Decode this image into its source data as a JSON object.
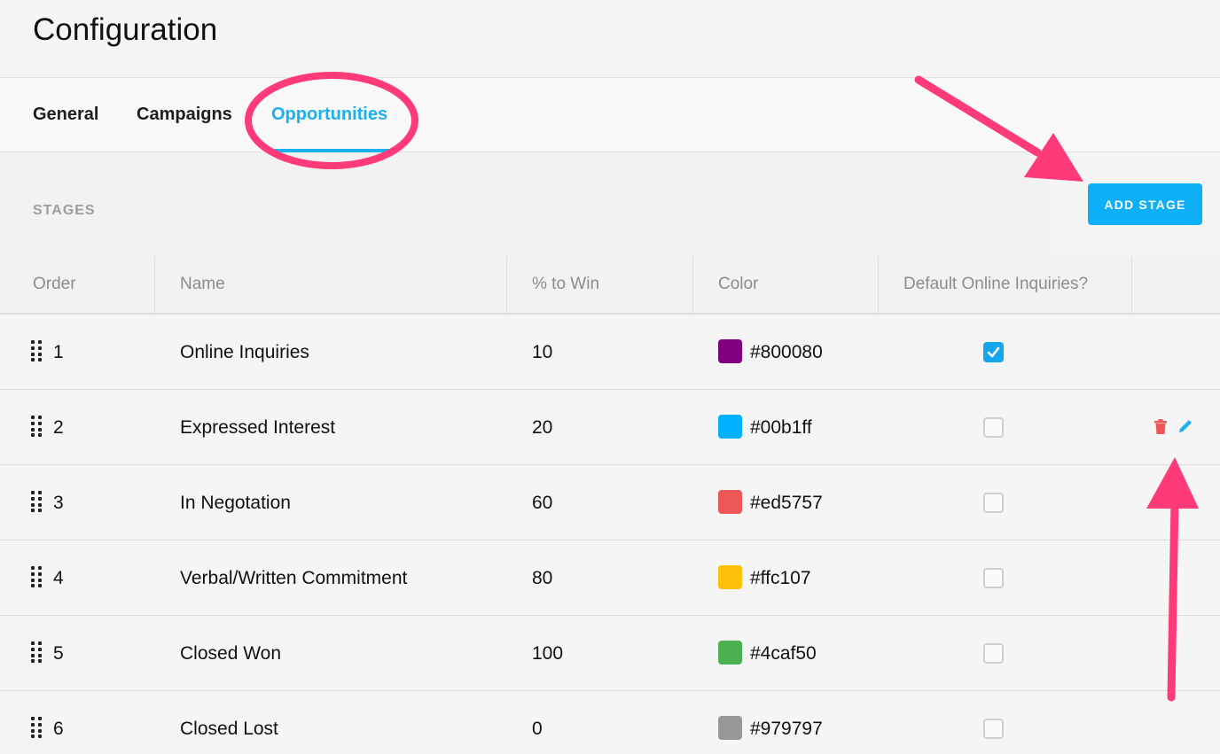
{
  "page": {
    "title": "Configuration"
  },
  "tabs": [
    {
      "label": "General"
    },
    {
      "label": "Campaigns"
    },
    {
      "label": "Opportunities",
      "active": true
    }
  ],
  "section": {
    "title": "STAGES",
    "add_button": "ADD STAGE"
  },
  "table": {
    "columns": [
      "Order",
      "Name",
      "% to Win",
      "Color",
      "Default Online Inquiries?"
    ],
    "rows": [
      {
        "order": "1",
        "name": "Online Inquiries",
        "win": "10",
        "color": "#800080",
        "default": true
      },
      {
        "order": "2",
        "name": "Expressed Interest",
        "win": "20",
        "color": "#00b1ff",
        "default": false,
        "actions": true
      },
      {
        "order": "3",
        "name": "In Negotation",
        "win": "60",
        "color": "#ed5757",
        "default": false
      },
      {
        "order": "4",
        "name": "Verbal/Written Commitment",
        "win": "80",
        "color": "#ffc107",
        "default": false
      },
      {
        "order": "5",
        "name": "Closed Won",
        "win": "100",
        "color": "#4caf50",
        "default": false
      },
      {
        "order": "6",
        "name": "Closed Lost",
        "win": "0",
        "color": "#979797",
        "default": false
      }
    ]
  },
  "colors": {
    "accent": "#1ab0f0",
    "annotation": "#ff3a78",
    "delete": "#ed5757"
  },
  "icons": [
    "drag-handle-icon",
    "checkmark-icon",
    "trash-icon",
    "pencil-icon"
  ]
}
